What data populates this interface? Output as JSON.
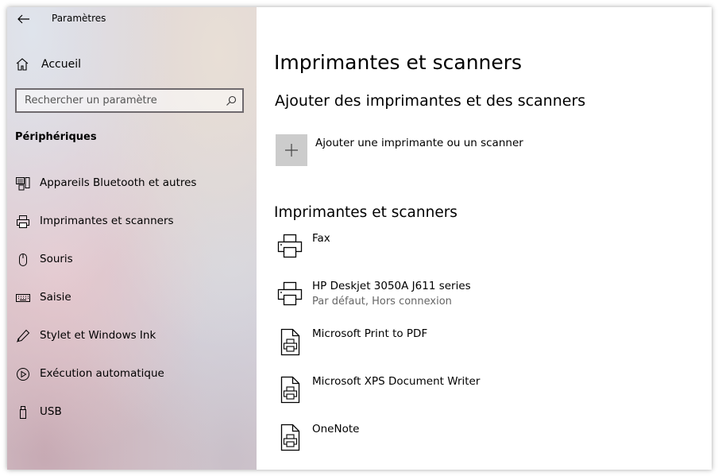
{
  "window": {
    "title": "Paramètres"
  },
  "sidebar": {
    "home_label": "Accueil",
    "search_placeholder": "Rechercher un paramètre",
    "section_title": "Périphériques",
    "items": [
      {
        "label": "Appareils Bluetooth et autres",
        "icon": "bluetooth-devices-icon"
      },
      {
        "label": "Imprimantes et scanners",
        "icon": "printer-icon"
      },
      {
        "label": "Souris",
        "icon": "mouse-icon"
      },
      {
        "label": "Saisie",
        "icon": "keyboard-icon"
      },
      {
        "label": "Stylet et Windows Ink",
        "icon": "pen-icon"
      },
      {
        "label": "Exécution automatique",
        "icon": "autoplay-icon"
      },
      {
        "label": "USB",
        "icon": "usb-icon"
      }
    ]
  },
  "main": {
    "title": "Imprimantes et scanners",
    "add_section_title": "Ajouter des imprimantes et des scanners",
    "add_label": "Ajouter une imprimante ou un scanner",
    "list_title": "Imprimantes et scanners",
    "printers": [
      {
        "name": "Fax",
        "status": "",
        "icon": "fax-printer-icon"
      },
      {
        "name": "HP Deskjet 3050A J611 series",
        "status": "Par défaut, Hors connexion",
        "icon": "printer-icon"
      },
      {
        "name": "Microsoft Print to PDF",
        "status": "",
        "icon": "document-printer-icon"
      },
      {
        "name": "Microsoft XPS Document Writer",
        "status": "",
        "icon": "document-printer-icon"
      },
      {
        "name": "OneNote",
        "status": "",
        "icon": "document-printer-icon"
      }
    ]
  }
}
